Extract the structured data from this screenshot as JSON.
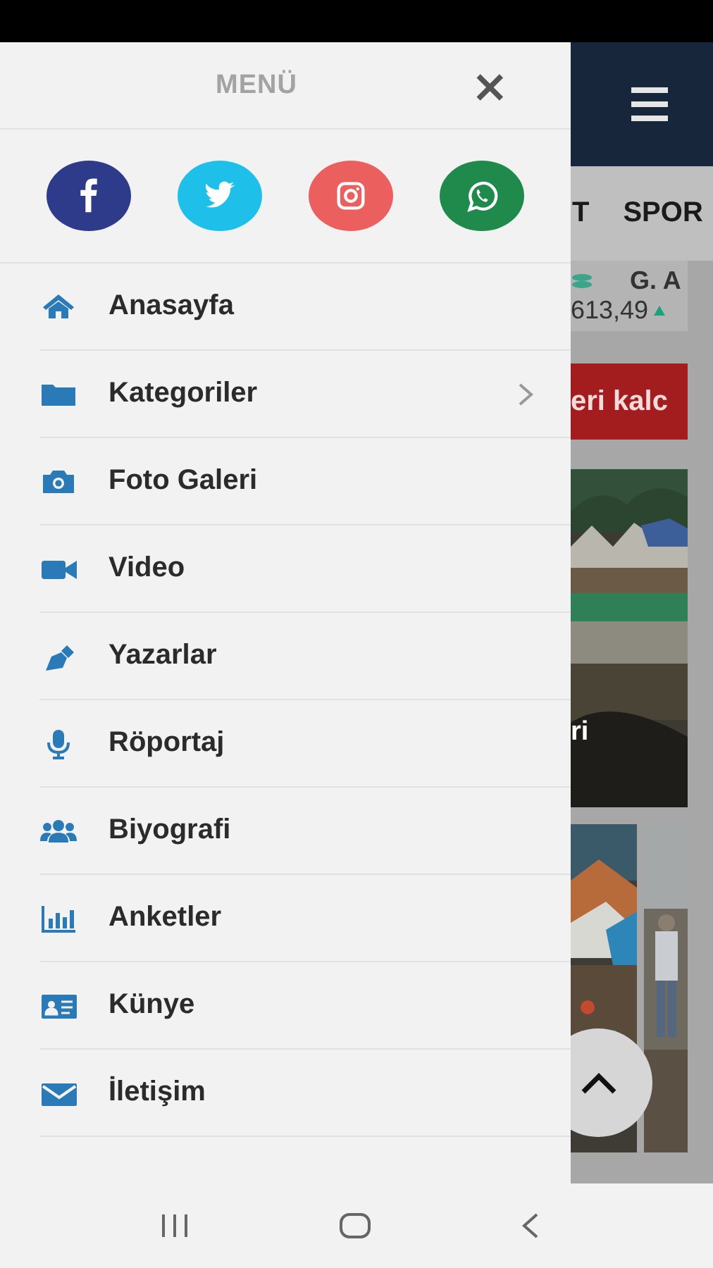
{
  "menu": {
    "title": "MENÜ",
    "close": "×",
    "social": [
      {
        "kind": "facebook",
        "color": "#2e3b8a"
      },
      {
        "kind": "twitter",
        "color": "#1ec0ea"
      },
      {
        "kind": "instagram",
        "color": "#ec5f5f"
      },
      {
        "kind": "whatsapp",
        "color": "#1f8a4c"
      }
    ],
    "items": [
      {
        "kind": "home",
        "label": "Anasayfa",
        "expandable": false
      },
      {
        "kind": "folder",
        "label": "Kategoriler",
        "expandable": true
      },
      {
        "kind": "camera",
        "label": "Foto Galeri",
        "expandable": false
      },
      {
        "kind": "video",
        "label": "Video",
        "expandable": false
      },
      {
        "kind": "pen",
        "label": "Yazarlar",
        "expandable": false
      },
      {
        "kind": "mic",
        "label": "Röportaj",
        "expandable": false
      },
      {
        "kind": "users",
        "label": "Biyografi",
        "expandable": false
      },
      {
        "kind": "chart",
        "label": "Anketler",
        "expandable": false
      },
      {
        "kind": "card",
        "label": "Künye",
        "expandable": false
      },
      {
        "kind": "mail",
        "label": "İletişim",
        "expandable": false
      }
    ]
  },
  "background_page": {
    "tabs": [
      "T",
      "SPOR"
    ],
    "ticker": {
      "name": "G. A",
      "value": "613,49"
    },
    "banner": "eri kalc",
    "headline": "ri"
  }
}
